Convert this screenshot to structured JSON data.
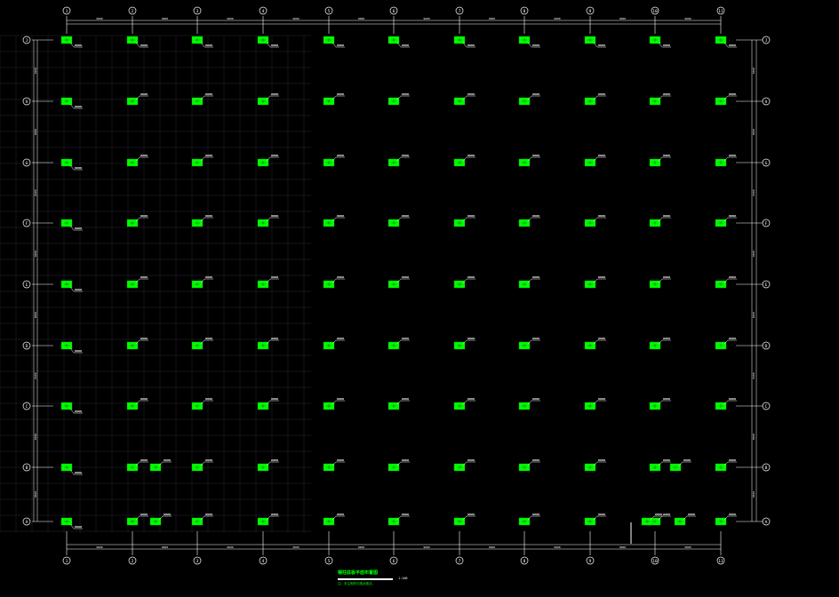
{
  "drawing": {
    "title": "钢柱底板平面布置图",
    "scale": "1:100",
    "note": "注：未注明的均按此做法。"
  },
  "grid": {
    "columns": [
      "1",
      "2",
      "3",
      "4",
      "5",
      "6",
      "7",
      "8",
      "9",
      "10",
      "11"
    ],
    "rows": [
      "J",
      "H",
      "G",
      "F",
      "E",
      "D",
      "C",
      "B",
      "A"
    ],
    "bay_width_label": "9000",
    "bay_height_label": "8400"
  },
  "colors": {
    "background": "#000000",
    "axis": "#ffffff",
    "plate": "#00ff00",
    "label": "#ffffff",
    "minor_grid": "#2a2a3a",
    "dim": "#ffffff"
  }
}
